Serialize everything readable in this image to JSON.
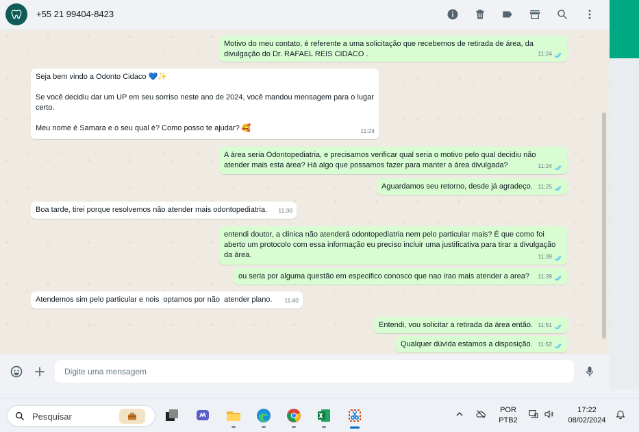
{
  "header": {
    "contact_name": "+55 21 99404-8423",
    "icons": [
      "info-icon",
      "trash-icon",
      "label-icon",
      "store-icon",
      "search-icon",
      "menu-icon"
    ]
  },
  "messages": [
    {
      "dir": "out",
      "text": "Motivo do meu contato, é referente a uma solicitação que recebemos de retirada de área, da divulgação do Dr. RAFAEL REIS CIDACO .",
      "time": "11:24",
      "read": true
    },
    {
      "dir": "in",
      "text": "Seja bem vindo a Odonto Cidaco 💙✨\n\nSe você decidiu dar um UP em seu sorriso neste ano de 2024, você mandou mensagem para o lugar certo.\n\nMeu nome é Samara e o seu qual é? Como posso te ajudar? 🥰",
      "time": "11:24"
    },
    {
      "dir": "out",
      "text": "A área seria Odontopediatria, e precisamos verificar qual seria o motivo pelo qual decidiu não atender mais esta área? Há algo que possamos fazer para manter a área divulgada?",
      "time": "11:24",
      "read": true
    },
    {
      "dir": "out",
      "text": "Aguardamos seu retorno, desde já agradeço.",
      "time": "11:25",
      "read": true
    },
    {
      "dir": "in",
      "text": "Boa tarde, tirei porque resolvemos não atender mais odontopediatria.",
      "time": "11:30"
    },
    {
      "dir": "out",
      "text": "entendi doutor, a clinica não atenderá odontopediatria nem pelo particular mais? É que como foi aberto um protocolo com essa informação eu preciso incluir uma justificativa para tirar a divulgação da área.",
      "time": "11:39",
      "read": true
    },
    {
      "dir": "out",
      "text": "ou seria por alguma questão em especifico conosco que nao irao mais atender a area?",
      "time": "11:39",
      "read": true
    },
    {
      "dir": "in",
      "text": "Atendemos sim pelo particular e nois  optamos por não  atender plano.",
      "time": "11:40"
    },
    {
      "dir": "out",
      "text": "Entendi, vou solicitar a retirada da área então.",
      "time": "11:51",
      "read": true
    },
    {
      "dir": "out",
      "text": "Qualquer dúvida estamos a disposição.",
      "time": "11:52",
      "read": true
    }
  ],
  "composer": {
    "placeholder": "Digite uma mensagem"
  },
  "taskbar": {
    "search_label": "Pesquisar",
    "lang_line1": "POR",
    "lang_line2": "PTB2",
    "time": "17:22",
    "date": "08/02/2024"
  },
  "colors": {
    "accent": "#00a884",
    "outgoing_bubble": "#d9fdd3",
    "incoming_bubble": "#ffffff",
    "read_ticks": "#53bdeb"
  }
}
